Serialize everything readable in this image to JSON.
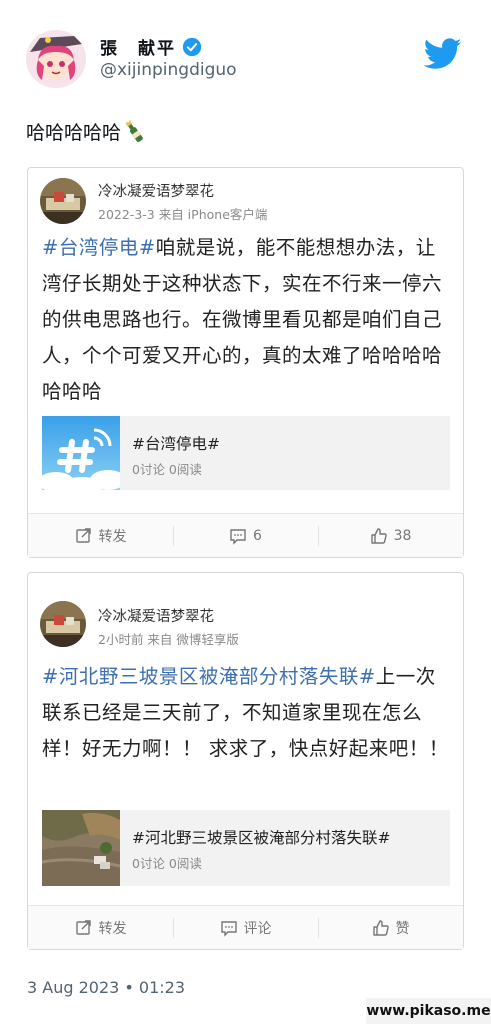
{
  "tweet": {
    "display_name": "張　献平",
    "handle": "@xijinpingdiguo",
    "text": "哈哈哈哈哈",
    "timestamp": "3 Aug 2023 • 01:23"
  },
  "posts": [
    {
      "user": "冷冰凝爱语梦翠花",
      "meta": "2022-3-3 来自 iPhone客户端",
      "hashtag": "#台湾停电#",
      "body": "咱就是说，能不能想想办法，让湾仔长期处于这种状态下，实在不行来一停六的供电思路也行。在微博里看见都是咱们自己人，个个可爱又开心的，真的太难了哈哈哈哈哈哈哈",
      "topic_title": "#台湾停电#",
      "topic_stats": "0讨论 0阅读",
      "actions": {
        "repost": "转发",
        "comment": "6",
        "like": "38"
      }
    },
    {
      "user": "冷冰凝爱语梦翠花",
      "meta": "2小时前 来自 微博轻享版",
      "hashtag": "#河北野三坡景区被淹部分村落失联#",
      "body": "上一次联系已经是三天前了，不知道家里现在怎么样！好无力啊！！ 求求了，快点好起来吧！！",
      "topic_title": "#河北野三坡景区被淹部分村落失联#",
      "topic_stats": "0讨论 0阅读",
      "actions": {
        "repost": "转发",
        "comment": "评论",
        "like": "赞"
      }
    }
  ],
  "watermark": "www.pikaso.me",
  "colors": {
    "twitter_blue": "#1d9bf0",
    "weibo_link": "#3d6fb0"
  }
}
